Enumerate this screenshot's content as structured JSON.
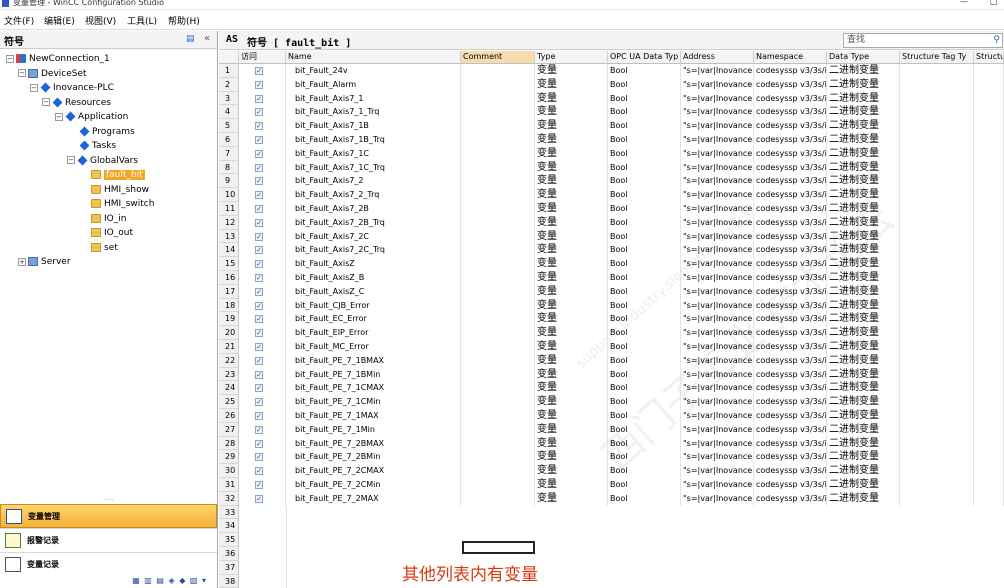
{
  "window": {
    "title": "变量管理 - WinCC Configuration Studio",
    "controls": [
      "—",
      "□"
    ]
  },
  "menu": [
    "文件(F)",
    "编辑(E)",
    "视图(V)",
    "工具(L)",
    "帮助(H)"
  ],
  "left_panel": {
    "title": "符号",
    "tree": [
      {
        "label": "NewConnection_1",
        "icon": "connection-icon"
      },
      {
        "label": "DeviceSet",
        "icon": "device-icon"
      },
      {
        "label": "Inovance-PLC",
        "icon": "node-icon"
      },
      {
        "label": "Resources",
        "icon": "node-icon"
      },
      {
        "label": "Application",
        "icon": "node-icon"
      },
      {
        "label": "Programs",
        "icon": "node-icon"
      },
      {
        "label": "Tasks",
        "icon": "node-icon"
      },
      {
        "label": "GlobalVars",
        "icon": "node-icon"
      },
      {
        "label": "fault_bit",
        "icon": "folder-icon",
        "selected": true
      },
      {
        "label": "HMI_show",
        "icon": "folder-icon"
      },
      {
        "label": "HMI_switch",
        "icon": "folder-icon"
      },
      {
        "label": "IO_in",
        "icon": "folder-icon"
      },
      {
        "label": "IO_out",
        "icon": "folder-icon"
      },
      {
        "label": "set",
        "icon": "folder-icon"
      },
      {
        "label": "Server",
        "icon": "device-icon"
      }
    ],
    "nav": [
      {
        "label": "变量管理",
        "active": true
      },
      {
        "label": "报警记录",
        "active": false
      },
      {
        "label": "变量记录",
        "active": false
      }
    ]
  },
  "main": {
    "as_label": "AS",
    "title": "符号 [ fault_bit ]",
    "search_placeholder": "查找",
    "columns": [
      "访问",
      "Name",
      "Comment",
      "Type",
      "OPC UA Data Typ",
      "Address",
      "Namespace",
      "Data Type",
      "Structure Tag Ty",
      "Structu"
    ],
    "rows": [
      {
        "no": "1",
        "name": "bit_Fault_24v"
      },
      {
        "no": "2",
        "name": "bit_Fault_Alarm"
      },
      {
        "no": "3",
        "name": "bit_Fault_Axis7_1"
      },
      {
        "no": "4",
        "name": "bit_Fault_Axis7_1_Trq"
      },
      {
        "no": "5",
        "name": "bit_Fault_Axis7_1B"
      },
      {
        "no": "6",
        "name": "bit_Fault_Axis7_1B_Trq"
      },
      {
        "no": "7",
        "name": "bit_Fault_Axis7_1C"
      },
      {
        "no": "8",
        "name": "bit_Fault_Axis7_1C_Trq"
      },
      {
        "no": "9",
        "name": "bit_Fault_Axis7_2"
      },
      {
        "no": "10",
        "name": "bit_Fault_Axis7_2_Trq"
      },
      {
        "no": "11",
        "name": "bit_Fault_Axis7_2B"
      },
      {
        "no": "12",
        "name": "bit_Fault_Axis7_2B_Trq"
      },
      {
        "no": "13",
        "name": "bit_Fault_Axis7_2C"
      },
      {
        "no": "14",
        "name": "bit_Fault_Axis7_2C_Trq"
      },
      {
        "no": "15",
        "name": "bit_Fault_AxisZ"
      },
      {
        "no": "16",
        "name": "bit_Fault_AxisZ_B"
      },
      {
        "no": "17",
        "name": "bit_Fault_AxisZ_C"
      },
      {
        "no": "18",
        "name": "bit_Fault_CJB_Error"
      },
      {
        "no": "19",
        "name": "bit_Fault_EC_Error"
      },
      {
        "no": "20",
        "name": "bit_Fault_EIP_Error"
      },
      {
        "no": "21",
        "name": "bit_Fault_MC_Error"
      },
      {
        "no": "22",
        "name": "bit_Fault_PE_7_1BMAX"
      },
      {
        "no": "23",
        "name": "bit_Fault_PE_7_1BMin"
      },
      {
        "no": "24",
        "name": "bit_Fault_PE_7_1CMAX"
      },
      {
        "no": "25",
        "name": "bit_Fault_PE_7_1CMin"
      },
      {
        "no": "26",
        "name": "bit_Fault_PE_7_1MAX"
      },
      {
        "no": "27",
        "name": "bit_Fault_PE_7_1Min"
      },
      {
        "no": "28",
        "name": "bit_Fault_PE_7_2BMAX"
      },
      {
        "no": "29",
        "name": "bit_Fault_PE_7_2BMin"
      },
      {
        "no": "30",
        "name": "bit_Fault_PE_7_2CMAX"
      },
      {
        "no": "31",
        "name": "bit_Fault_PE_7_2CMin"
      },
      {
        "no": "32",
        "name": "bit_Fault_PE_7_2MAX"
      }
    ],
    "common": {
      "type": "变量",
      "opc": "Bool",
      "address": "\"s=|var|Inovance",
      "namespace": "codesyssp v3/3s/i",
      "datatype": "二进制变量"
    },
    "empty_rows": [
      "33",
      "34",
      "35",
      "36",
      "37",
      "38"
    ],
    "annotation": "其他列表内有变量",
    "watermark": "西门子工业 技术论坛",
    "watermark_url": "support.industry.siemens.com/cs"
  },
  "colors": {
    "selection": "#f5a523",
    "annotation": "#d93a12",
    "comment_header": "#f8dcb0"
  }
}
